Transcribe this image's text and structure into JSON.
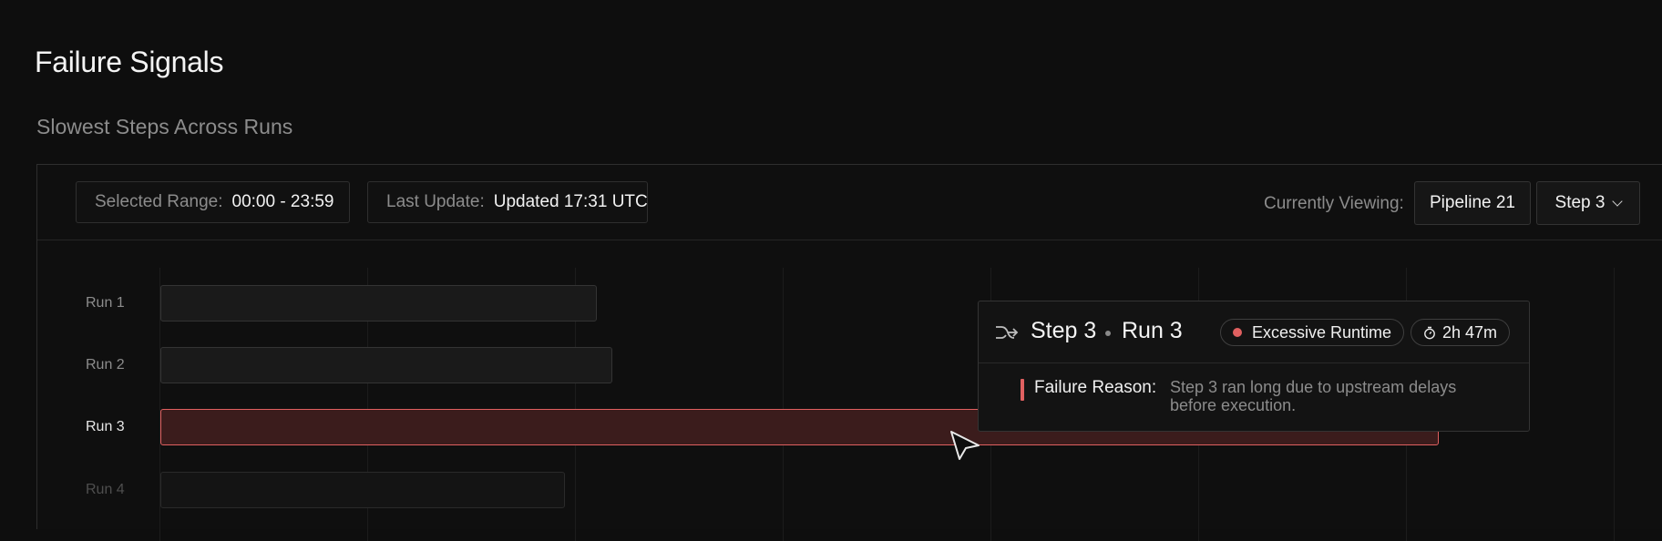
{
  "page": {
    "title": "Failure Signals",
    "section_title": "Slowest Steps Across Runs"
  },
  "toolbar": {
    "range_label": "Selected Range:",
    "range_value": "00:00 - 23:59",
    "update_label": "Last Update:",
    "update_value": "Updated 17:31 UTC",
    "viewing_label": "Currently Viewing:",
    "pipeline_button": "Pipeline 21",
    "step_select": "Step 3"
  },
  "runs": [
    {
      "label": "Run 1",
      "state": "normal"
    },
    {
      "label": "Run 2",
      "state": "normal"
    },
    {
      "label": "Run 3",
      "state": "failed"
    },
    {
      "label": "Run 4",
      "state": "faded"
    }
  ],
  "tooltip": {
    "step": "Step 3",
    "run": "Run 3",
    "badge": "Excessive Runtime",
    "duration": "2h 47m",
    "reason_label": "Failure Reason:",
    "reason_text": "Step 3 ran long due to upstream delays before execution."
  },
  "icons": {
    "tooltip_icon": "merge-arrow-icon",
    "badge_icon": "status-dot-icon",
    "duration_icon": "stopwatch-icon",
    "select_icon": "chevron-down-icon",
    "pointer": "cursor-pointer-icon"
  },
  "colors": {
    "background": "#0e0e0e",
    "failure": "#e06060",
    "failure_fill": "#3b1c1c",
    "muted_text": "#8c8c8c"
  }
}
